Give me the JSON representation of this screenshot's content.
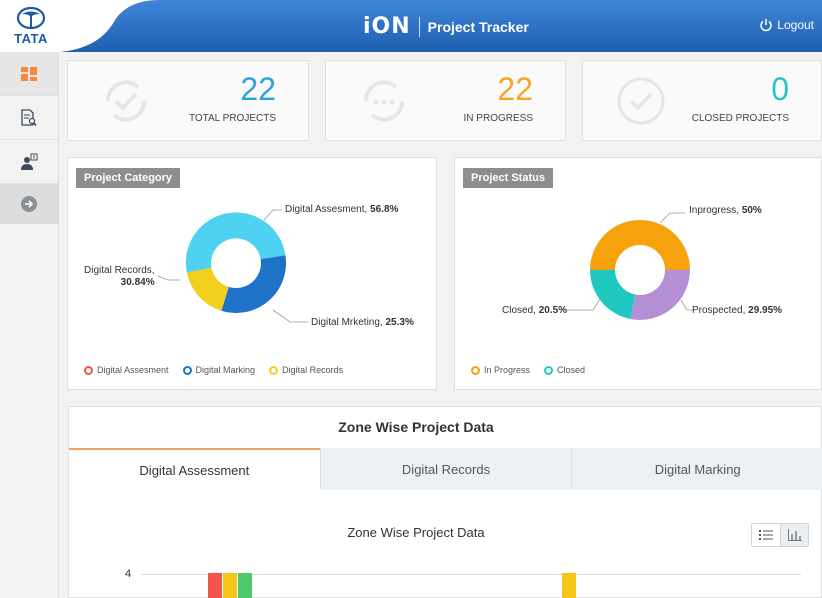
{
  "header": {
    "logo_text": "TATA",
    "brand": "iON",
    "title": "Project Tracker",
    "logout_label": "Logout"
  },
  "sidebar": {
    "items": [
      {
        "icon": "dashboard-icon"
      },
      {
        "icon": "document-search-icon"
      },
      {
        "icon": "user-badge-icon"
      },
      {
        "icon": "arrow-right-icon"
      }
    ]
  },
  "stats": [
    {
      "value": "22",
      "label": "TOTAL PROJECTS",
      "color": "#2fa3d8"
    },
    {
      "value": "22",
      "label": "IN PROGRESS",
      "color": "#f5a623"
    },
    {
      "value": "0",
      "label": "CLOSED PROJECTS",
      "color": "#26c6c6"
    }
  ],
  "category_panel": {
    "title": "Project Category",
    "callouts": [
      {
        "label": "Digital Assesment,",
        "value": "56.8%"
      },
      {
        "label": "Digital Mrketing,",
        "value": "25.3%"
      },
      {
        "label": "Digital Records,",
        "value": "30.84%"
      }
    ],
    "legend": [
      "Digital Assesment",
      "Digital Marking",
      "Digital Records"
    ]
  },
  "status_panel": {
    "title": "Project Status",
    "callouts": [
      {
        "label": "Inprogress,",
        "value": "50%"
      },
      {
        "label": "Prospected,",
        "value": "29.95%"
      },
      {
        "label": "Closed,",
        "value": "20.5%"
      }
    ],
    "legend": [
      "In Progress",
      "Closed"
    ]
  },
  "zone": {
    "title": "Zone Wise Project Data",
    "tabs": [
      "Digital Assessment",
      "Digital Records",
      "Digital Marking"
    ],
    "chart_title": "Zone Wise Project Data",
    "y_tick": "4"
  },
  "colors": {
    "header_blue": "#2e6fc0",
    "digital_assesment": "#4fd2f2",
    "digital_marking": "#1e73c8",
    "digital_records": "#f2cf1c",
    "inprogress": "#f5a20c",
    "prospected": "#b48fd6",
    "closed": "#20c9c0",
    "bar_red": "#f0564e",
    "bar_yellow": "#f5c518",
    "bar_green": "#4cc96b"
  }
}
